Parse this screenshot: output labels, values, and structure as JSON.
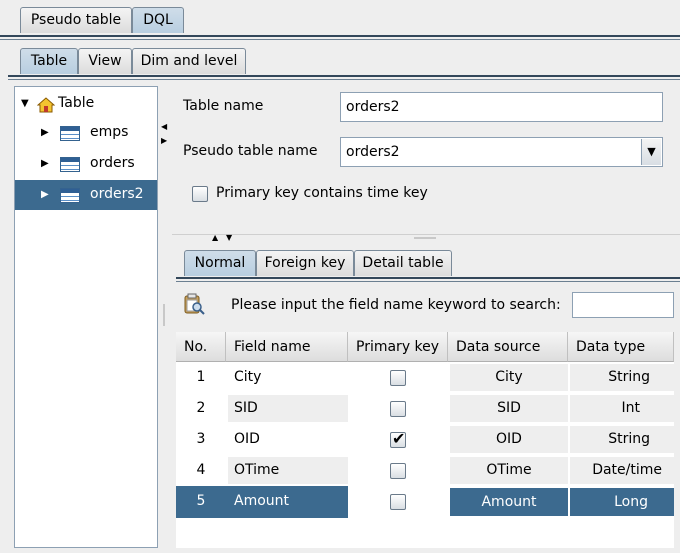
{
  "top_tabs": [
    "Pseudo table",
    "DQL"
  ],
  "sub_tabs": [
    "Table",
    "View",
    "Dim and level"
  ],
  "tree": {
    "root_label": "Table",
    "items": [
      "emps",
      "orders",
      "orders2"
    ]
  },
  "form": {
    "table_name_label": "Table name",
    "table_name_value": "orders2",
    "pseudo_label": "Pseudo table name",
    "pseudo_value": "orders2",
    "primary_time_label": "Primary key contains time key"
  },
  "field_tabs": [
    "Normal",
    "Foreign key",
    "Detail table"
  ],
  "search": {
    "label": "Please input the field name keyword to search:",
    "value": ""
  },
  "grid": {
    "headers": [
      "No.",
      "Field name",
      "Primary key",
      "Data source",
      "Data type"
    ],
    "rows": [
      {
        "no": "1",
        "field": "City",
        "pk": false,
        "source": "City",
        "type": "String"
      },
      {
        "no": "2",
        "field": "SID",
        "pk": false,
        "source": "SID",
        "type": "Int"
      },
      {
        "no": "3",
        "field": "OID",
        "pk": true,
        "source": "OID",
        "type": "String"
      },
      {
        "no": "4",
        "field": "OTime",
        "pk": false,
        "source": "OTime",
        "type": "Date/time"
      },
      {
        "no": "5",
        "field": "Amount",
        "pk": false,
        "source": "Amount",
        "type": "Long"
      }
    ]
  },
  "colors": {
    "selection": "#3c6a8f",
    "tab_selected": "#c3d6e6"
  }
}
